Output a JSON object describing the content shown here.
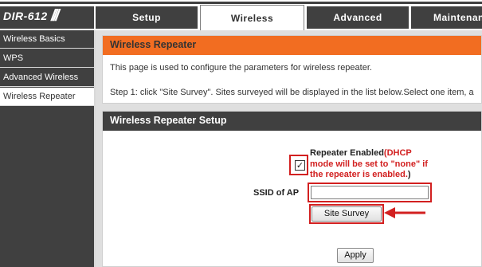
{
  "brand": {
    "model": "DIR-612"
  },
  "tabs": [
    {
      "label": "Setup"
    },
    {
      "label": "Wireless"
    },
    {
      "label": "Advanced"
    },
    {
      "label": "Maintenan"
    }
  ],
  "sidebar": {
    "items": [
      {
        "label": "Wireless Basics"
      },
      {
        "label": "WPS"
      },
      {
        "label": "Advanced Wireless"
      },
      {
        "label": "Wireless Repeater"
      }
    ]
  },
  "intro": {
    "title": "Wireless Repeater",
    "line1": "This page is used to configure the parameters for wireless repeater.",
    "line2": "Step 1: click \"Site Survey\". Sites surveyed will be displayed in the list below.Select one item, a"
  },
  "setup": {
    "title": "Wireless Repeater Setup",
    "repeater_label": "Repeater Enabled",
    "repeater_note_open": "(DHCP",
    "repeater_note_l2": "mode will be set to \"none\" if",
    "repeater_note_l3": "the repeater is enabled.",
    "repeater_note_close": ")",
    "repeater_checked": "✓",
    "ssid_label": "SSID of AP",
    "ssid_value": "",
    "site_survey_label": "Site Survey",
    "apply_label": "Apply"
  },
  "colors": {
    "accent_orange": "#f26d21",
    "dark_gray": "#404040",
    "highlight_red": "#d22020"
  },
  "icons": {
    "checkbox": "check-icon",
    "annotation": "arrow-left-icon"
  }
}
